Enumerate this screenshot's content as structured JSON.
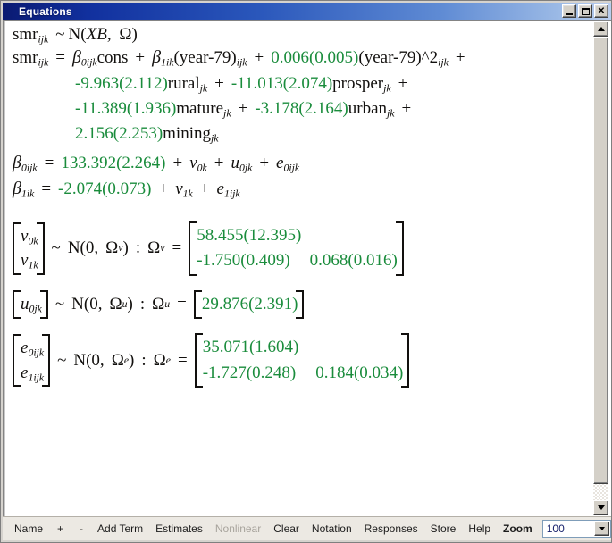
{
  "window": {
    "title": "Equations",
    "buttons": {
      "minimize": "_",
      "maximize": "□",
      "close": "✕"
    }
  },
  "equations": {
    "line1": {
      "lhs": "smr",
      "lhs_sub": "ijk",
      "tilde": "~",
      "dist": "N(",
      "dist_arg_italic": "XB",
      "dist_comma": ", ",
      "omega": "Ω",
      "close": ")"
    },
    "line2": {
      "lhs": "smr",
      "lhs_sub": "ijk",
      "eq": "=",
      "b0": "β",
      "b0_sub": "0ijk",
      "cons": "cons",
      "plus1": "+",
      "b1": "β",
      "b1_sub": "1ik",
      "yr": "(year-79)",
      "yr_sub": "ijk",
      "plus2": "+",
      "coef_quad": "0.006(0.005)",
      "quad_term": "(year-79)^2",
      "quad_sub": "ijk",
      "plus3": "+"
    },
    "line3": {
      "t1_coef": "-9.963(2.112)",
      "t1_var": "rural",
      "t1_sub": "jk",
      "plus1": "+",
      "t2_coef": "-11.013(2.074)",
      "t2_var": "prosper",
      "t2_sub": "jk",
      "plus2": "+"
    },
    "line4": {
      "t1_coef": "-11.389(1.936)",
      "t1_var": "mature",
      "t1_sub": "jk",
      "plus1": "+",
      "t2_coef": "-3.178(2.164)",
      "t2_var": "urban",
      "t2_sub": "jk",
      "plus2": "+"
    },
    "line5": {
      "t1_coef": "2.156(2.253)",
      "t1_var": "mining",
      "t1_sub": "jk"
    },
    "line6": {
      "beta": "β",
      "beta_sub": "0ijk",
      "eq": "=",
      "coef": "133.392(2.264)",
      "plus1": "+",
      "v": "v",
      "v_sub": "0k",
      "plus2": "+",
      "u": "u",
      "u_sub": "0jk",
      "plus3": "+",
      "e": "e",
      "e_sub": "0ijk"
    },
    "line7": {
      "beta": "β",
      "beta_sub": "1ik",
      "eq": "=",
      "coef": "-2.074(0.073)",
      "plus1": "+",
      "v": "v",
      "v_sub": "1k",
      "plus2": "+",
      "e": "e",
      "e_sub": "1ijk"
    }
  },
  "random_parts": [
    {
      "vector": [
        {
          "sym": "v",
          "sub": "0k"
        },
        {
          "sym": "v",
          "sub": "1k"
        }
      ],
      "tilde": "~",
      "dist": "N(0,",
      "omega": "Ω",
      "omega_sub": "v",
      "dist_close": ")",
      "colon": ":",
      "omega2": "Ω",
      "omega2_sub": "v",
      "eq": "=",
      "matrix": [
        [
          "58.455(12.395)"
        ],
        [
          "-1.750(0.409)",
          "0.068(0.016)"
        ]
      ]
    },
    {
      "vector": [
        {
          "sym": "u",
          "sub": "0jk"
        }
      ],
      "tilde": "~",
      "dist": "N(0,",
      "omega": "Ω",
      "omega_sub": "u",
      "dist_close": ")",
      "colon": ":",
      "omega2": "Ω",
      "omega2_sub": "u",
      "eq": "=",
      "matrix": [
        [
          "29.876(2.391)"
        ]
      ]
    },
    {
      "vector": [
        {
          "sym": "e",
          "sub": "0ijk"
        },
        {
          "sym": "e",
          "sub": "1ijk"
        }
      ],
      "tilde": "~",
      "dist": "N(0,",
      "omega": "Ω",
      "omega_sub": "e",
      "dist_close": ")",
      "colon": ":",
      "omega2": "Ω",
      "omega2_sub": "e",
      "eq": "=",
      "matrix": [
        [
          "35.071(1.604)"
        ],
        [
          "-1.727(0.248)",
          "0.184(0.034)"
        ]
      ]
    }
  ],
  "toolbar": {
    "items": [
      {
        "label": "Name",
        "disabled": false,
        "bold": false
      },
      {
        "label": "+",
        "disabled": false,
        "bold": false
      },
      {
        "label": "-",
        "disabled": false,
        "bold": false
      },
      {
        "label": "Add Term",
        "disabled": false,
        "bold": false
      },
      {
        "label": "Estimates",
        "disabled": false,
        "bold": false
      },
      {
        "label": "Nonlinear",
        "disabled": true,
        "bold": false
      },
      {
        "label": "Clear",
        "disabled": false,
        "bold": false
      },
      {
        "label": "Notation",
        "disabled": false,
        "bold": false
      },
      {
        "label": "Responses",
        "disabled": false,
        "bold": false
      },
      {
        "label": "Store",
        "disabled": false,
        "bold": false
      },
      {
        "label": "Help",
        "disabled": false,
        "bold": false
      },
      {
        "label": "Zoom",
        "disabled": false,
        "bold": true
      }
    ],
    "zoom_value": "100"
  },
  "colors": {
    "estimate_green": "#1a8c3c",
    "equation_black": "#12100e",
    "titlebar_blue": "#11309e",
    "toolbar_bg": "#ece9e3"
  }
}
